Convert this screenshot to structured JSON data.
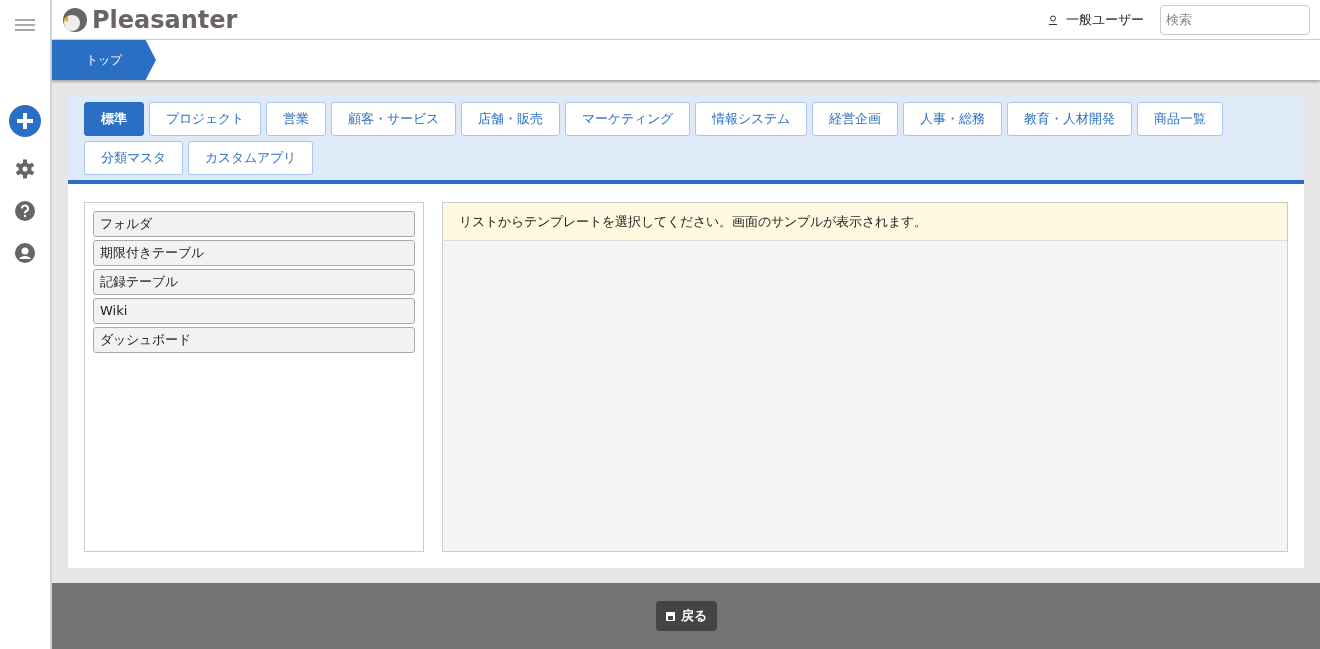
{
  "header": {
    "logo_text": "Pleasanter",
    "user": "一般ユーザー",
    "search": {
      "placeholder": "検索"
    }
  },
  "breadcrumb": [
    "トップ"
  ],
  "tabs": [
    {
      "label": "標準",
      "selected": true
    },
    {
      "label": "プロジェクト",
      "selected": false
    },
    {
      "label": "営業",
      "selected": false
    },
    {
      "label": "顧客・サービス",
      "selected": false
    },
    {
      "label": "店舗・販売",
      "selected": false
    },
    {
      "label": "マーケティング",
      "selected": false
    },
    {
      "label": "情報システム",
      "selected": false
    },
    {
      "label": "経営企画",
      "selected": false
    },
    {
      "label": "人事・総務",
      "selected": false
    },
    {
      "label": "教育・人材開発",
      "selected": false
    },
    {
      "label": "商品一覧",
      "selected": false
    },
    {
      "label": "分類マスタ",
      "selected": false
    },
    {
      "label": "カスタムアプリ",
      "selected": false
    }
  ],
  "templates": [
    "フォルダ",
    "期限付きテーブル",
    "記録テーブル",
    "Wiki",
    "ダッシュボード"
  ],
  "preview_message": "リストからテンプレートを選択してください。画面のサンプルが表示されます。",
  "footer": {
    "back_button": "戻る"
  }
}
